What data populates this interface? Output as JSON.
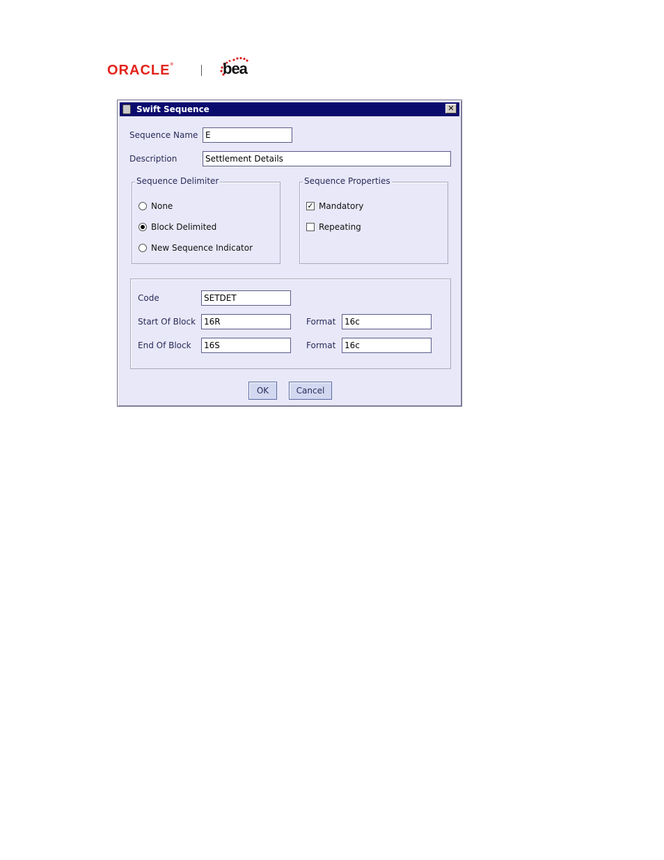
{
  "brand": {
    "oracle": "ORACLE",
    "bea": "bea"
  },
  "dialog": {
    "title": "Swift Sequence",
    "close_glyph": "✕",
    "sequence_name": {
      "label": "Sequence Name",
      "value": "E"
    },
    "description": {
      "label": "Description",
      "value": "Settlement Details"
    },
    "delimiter": {
      "legend": "Sequence Delimiter",
      "options": [
        {
          "label": "None",
          "checked": false
        },
        {
          "label": "Block Delimited",
          "checked": true
        },
        {
          "label": "New Sequence Indicator",
          "checked": false
        }
      ]
    },
    "properties": {
      "legend": "Sequence Properties",
      "mandatory": {
        "label": "Mandatory",
        "checked": true
      },
      "repeating": {
        "label": "Repeating",
        "checked": false
      }
    },
    "block": {
      "code": {
        "label": "Code",
        "value": "SETDET"
      },
      "start": {
        "label": "Start Of Block",
        "value": "16R",
        "format_label": "Format",
        "format_value": "16c"
      },
      "end": {
        "label": "End Of Block",
        "value": "16S",
        "format_label": "Format",
        "format_value": "16c"
      }
    },
    "ok_label": "OK",
    "cancel_label": "Cancel"
  },
  "colors": {
    "titlebar": "#0b0b6e",
    "dialog_bg": "#e8e8f8",
    "oracle_red": "#e2231a",
    "bea_red": "#d8201c"
  }
}
